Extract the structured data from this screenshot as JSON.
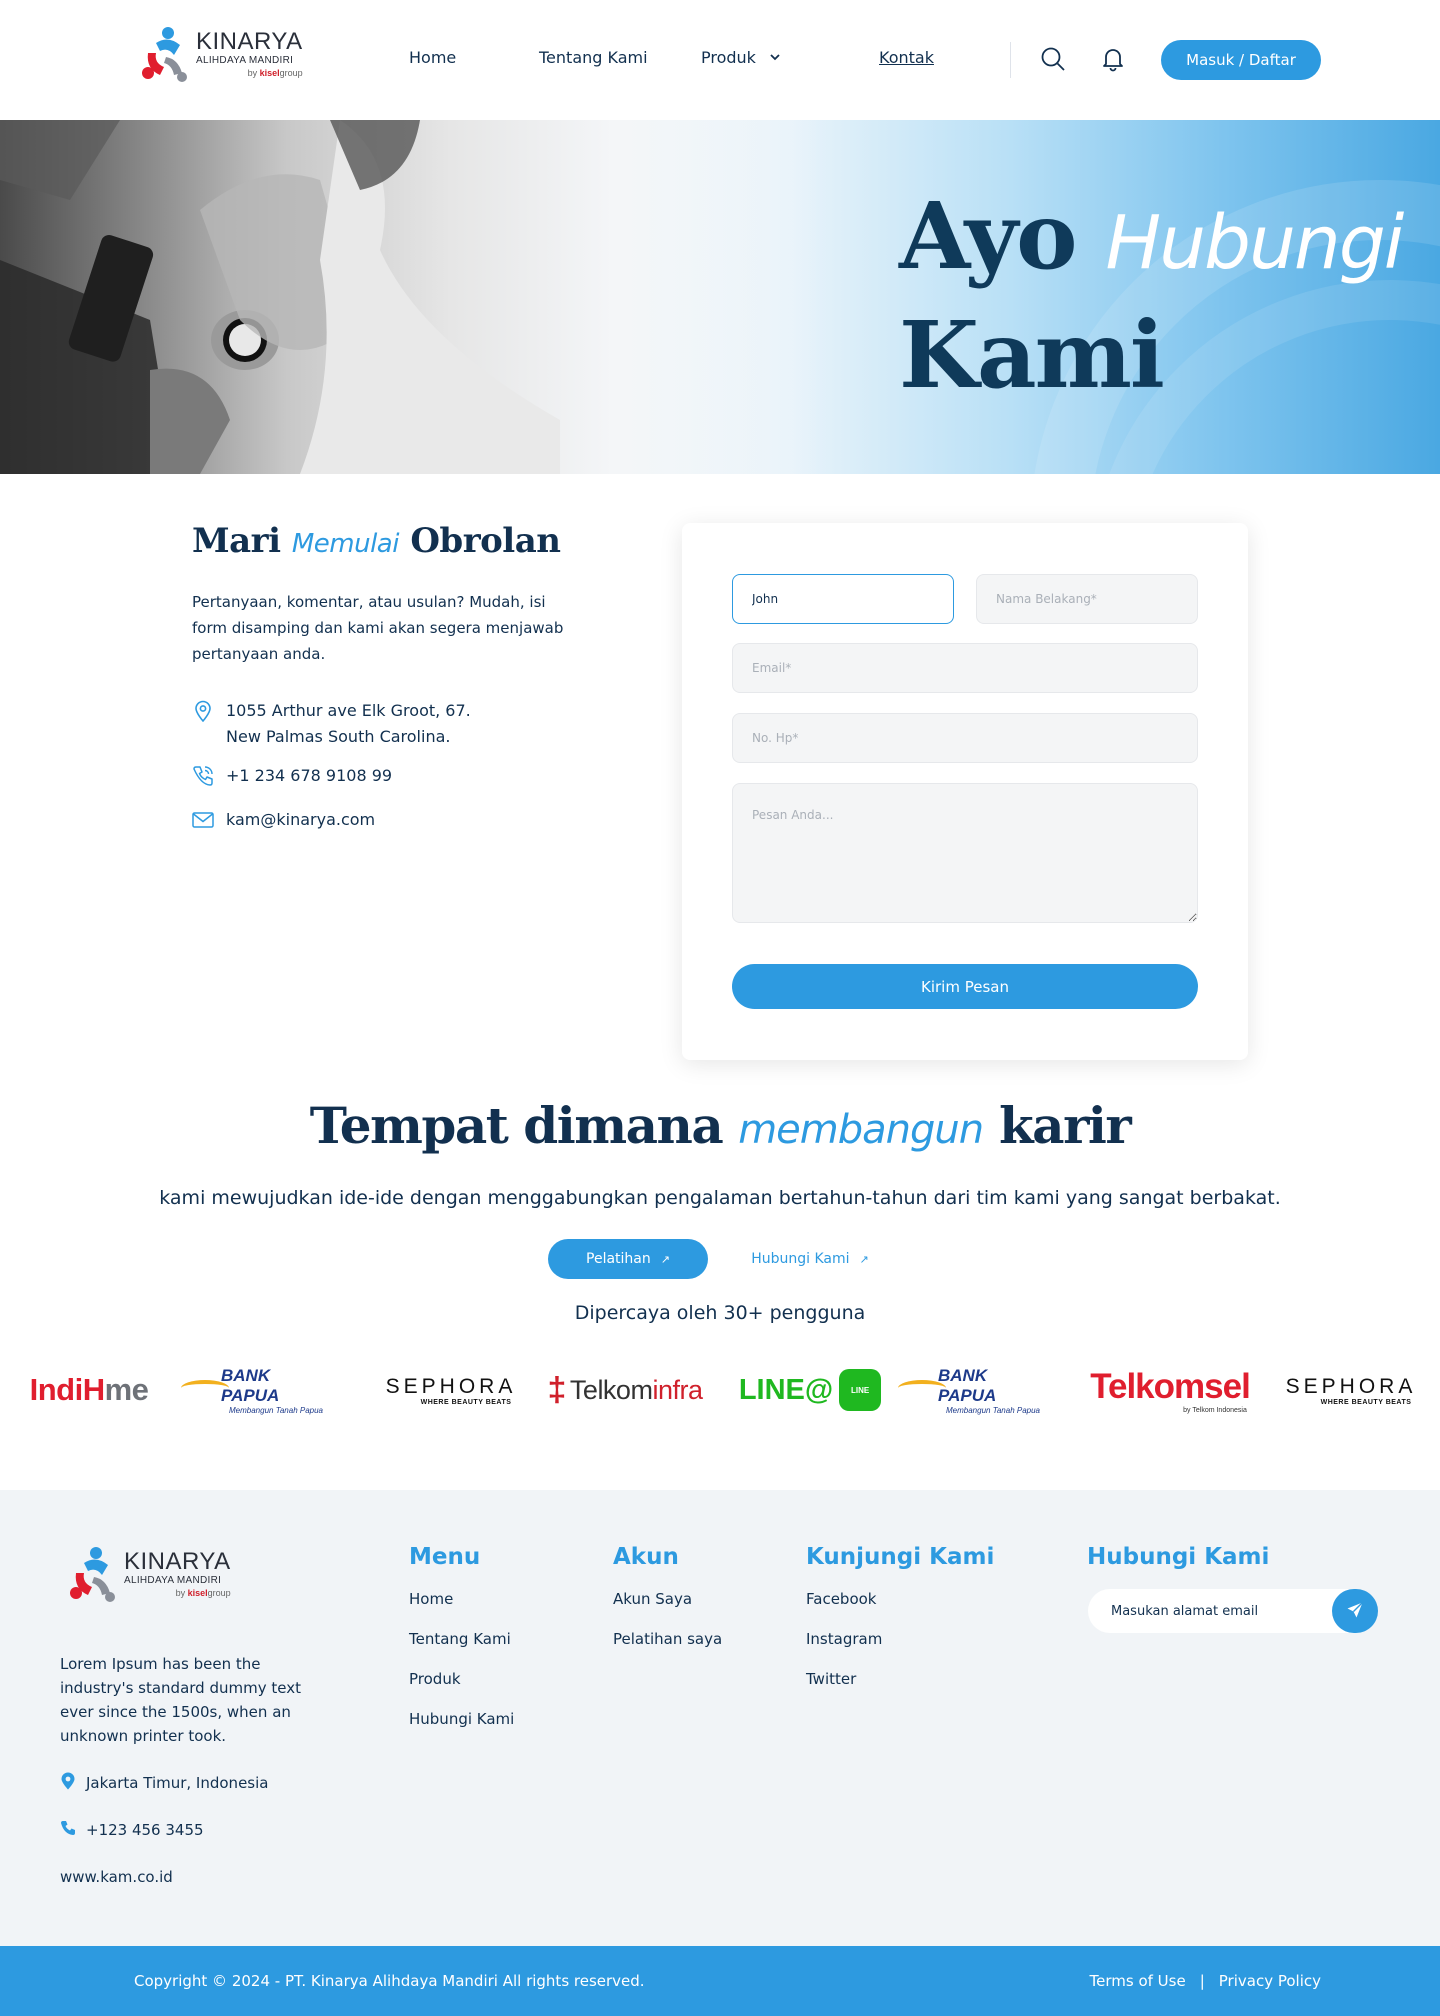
{
  "brand": {
    "name": "KINARYA",
    "sub": "ALIHDAYA MANDIRI",
    "by": "by",
    "group_brand": "kisel",
    "group": "group"
  },
  "nav": {
    "home": "Home",
    "about": "Tentang Kami",
    "produk": "Produk",
    "kontak": "Kontak",
    "login": "Masuk / Daftar"
  },
  "hero": {
    "word1": "Ayo",
    "word2": "Hubungi",
    "word3": "Kami"
  },
  "contact": {
    "title_a": "Mari",
    "title_b": "Memulai",
    "title_c": "Obrolan",
    "description": "Pertanyaan, komentar, atau usulan? Mudah, isi form disamping dan kami akan segera menjawab pertanyaan anda.",
    "address_line1": "1055 Arthur ave Elk Groot, 67.",
    "address_line2": "New Palmas South Carolina.",
    "phone": "+1 234 678 9108 99",
    "email": "kam@kinarya.com"
  },
  "form": {
    "first_name_value": "John",
    "last_name_placeholder": "Nama Belakang*",
    "email_placeholder": "Email*",
    "phone_placeholder": "No. Hp*",
    "message_placeholder": "Pesan Anda...",
    "submit": "Kirim Pesan"
  },
  "career": {
    "title_a": "Tempat dimana",
    "title_b": "membangun",
    "title_c": "karir",
    "description": "kami mewujudkan ide-ide dengan menggabungkan pengalaman bertahun-tahun dari tim kami yang sangat berbakat.",
    "btn_primary": "Pelatihan",
    "btn_secondary": "Hubungi Kami",
    "trusted": "Dipercaya oleh 30+ pengguna"
  },
  "brands": {
    "indihome_a": "Indi",
    "indihome_b": "H",
    "indihome_c": "me",
    "bank_papua": "BANK PAPUA",
    "bank_papua_tag": "Membangun Tanah Papua",
    "sephora": "SEPHORA",
    "sephora_tag": "WHERE BEAUTY BEATS",
    "telkominfra_a": "Telkom",
    "telkominfra_b": "infra",
    "line_text": "LINE@",
    "line_badge": "LINE",
    "telkomsel": "Telkomsel",
    "telkomsel_tag": "by Telkom Indonesia"
  },
  "footer": {
    "description": "Lorem Ipsum has been the industry's standard dummy text ever since the 1500s, when an unknown printer took.",
    "location": "Jakarta Timur, Indonesia",
    "phone": "+123 456 3455",
    "website": "www.kam.co.id",
    "menu_title": "Menu",
    "menu": [
      "Home",
      "Tentang Kami",
      "Produk",
      "Hubungi Kami"
    ],
    "akun_title": "Akun",
    "akun": [
      "Akun Saya",
      "Pelatihan saya"
    ],
    "visit_title": "Kunjungi Kami",
    "visit": [
      "Facebook",
      "Instagram",
      "Twitter"
    ],
    "contact_title": "Hubungi Kami",
    "newsletter_placeholder": "Masukan alamat email",
    "copyright": "Copyright © 2024 - PT. Kinarya Alihdaya Mandiri All rights reserved.",
    "terms": "Terms of Use",
    "separator": "|",
    "privacy": "Privacy Policy"
  },
  "colors": {
    "primary": "#2d9ae0",
    "navy": "#12304f",
    "footer_bg": "#f1f4f7"
  }
}
